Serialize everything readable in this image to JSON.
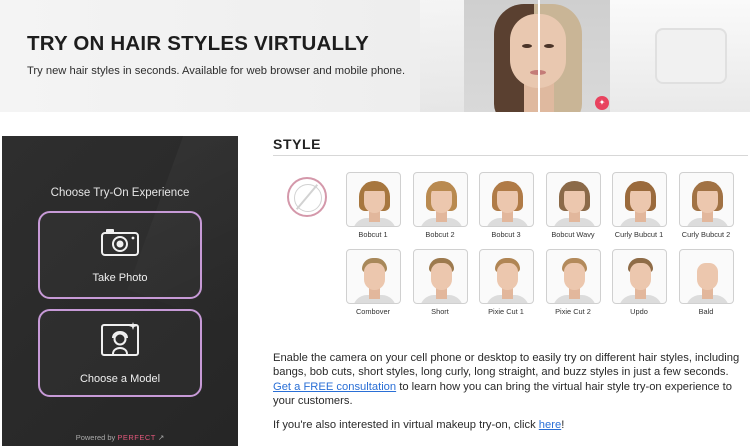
{
  "hero": {
    "title": "TRY ON HAIR STYLES VIRTUALLY",
    "subtitle": "Try new hair styles in seconds. Available for web browser and mobile phone."
  },
  "experience": {
    "title": "Choose Try-On Experience",
    "take_photo_label": "Take Photo",
    "choose_model_label": "Choose a Model",
    "powered_by": "Powered by",
    "brand": "PERFECT"
  },
  "style": {
    "heading": "STYLE",
    "row1": [
      "Bobcut 1",
      "Bobcut 2",
      "Bobcut 3",
      "Bobcut Wavy",
      "Curly Bubcut 1",
      "Curly Bubcut 2"
    ],
    "row2": [
      "Combover",
      "Short",
      "Pixie Cut 1",
      "Pixie Cut 2",
      "Updo",
      "Bald"
    ]
  },
  "description": {
    "text_before_link": "Enable the camera on your cell phone or desktop to easily try on different hair styles, including bangs, bob cuts, short styles, long curly, long straight, and buzz styles in just a few seconds. ",
    "link": "Get a FREE consultation",
    "text_after_link": " to learn how you can bring the virtual hair style try-on experience to your customers.",
    "makeup_before": "If you're also interested in virtual makeup try-on, click ",
    "makeup_link": "here",
    "makeup_after": "!"
  },
  "colors": {
    "accent_border": "#c79ad7",
    "brand_pink": "#e0577a",
    "link_blue": "#2a6fd6"
  }
}
